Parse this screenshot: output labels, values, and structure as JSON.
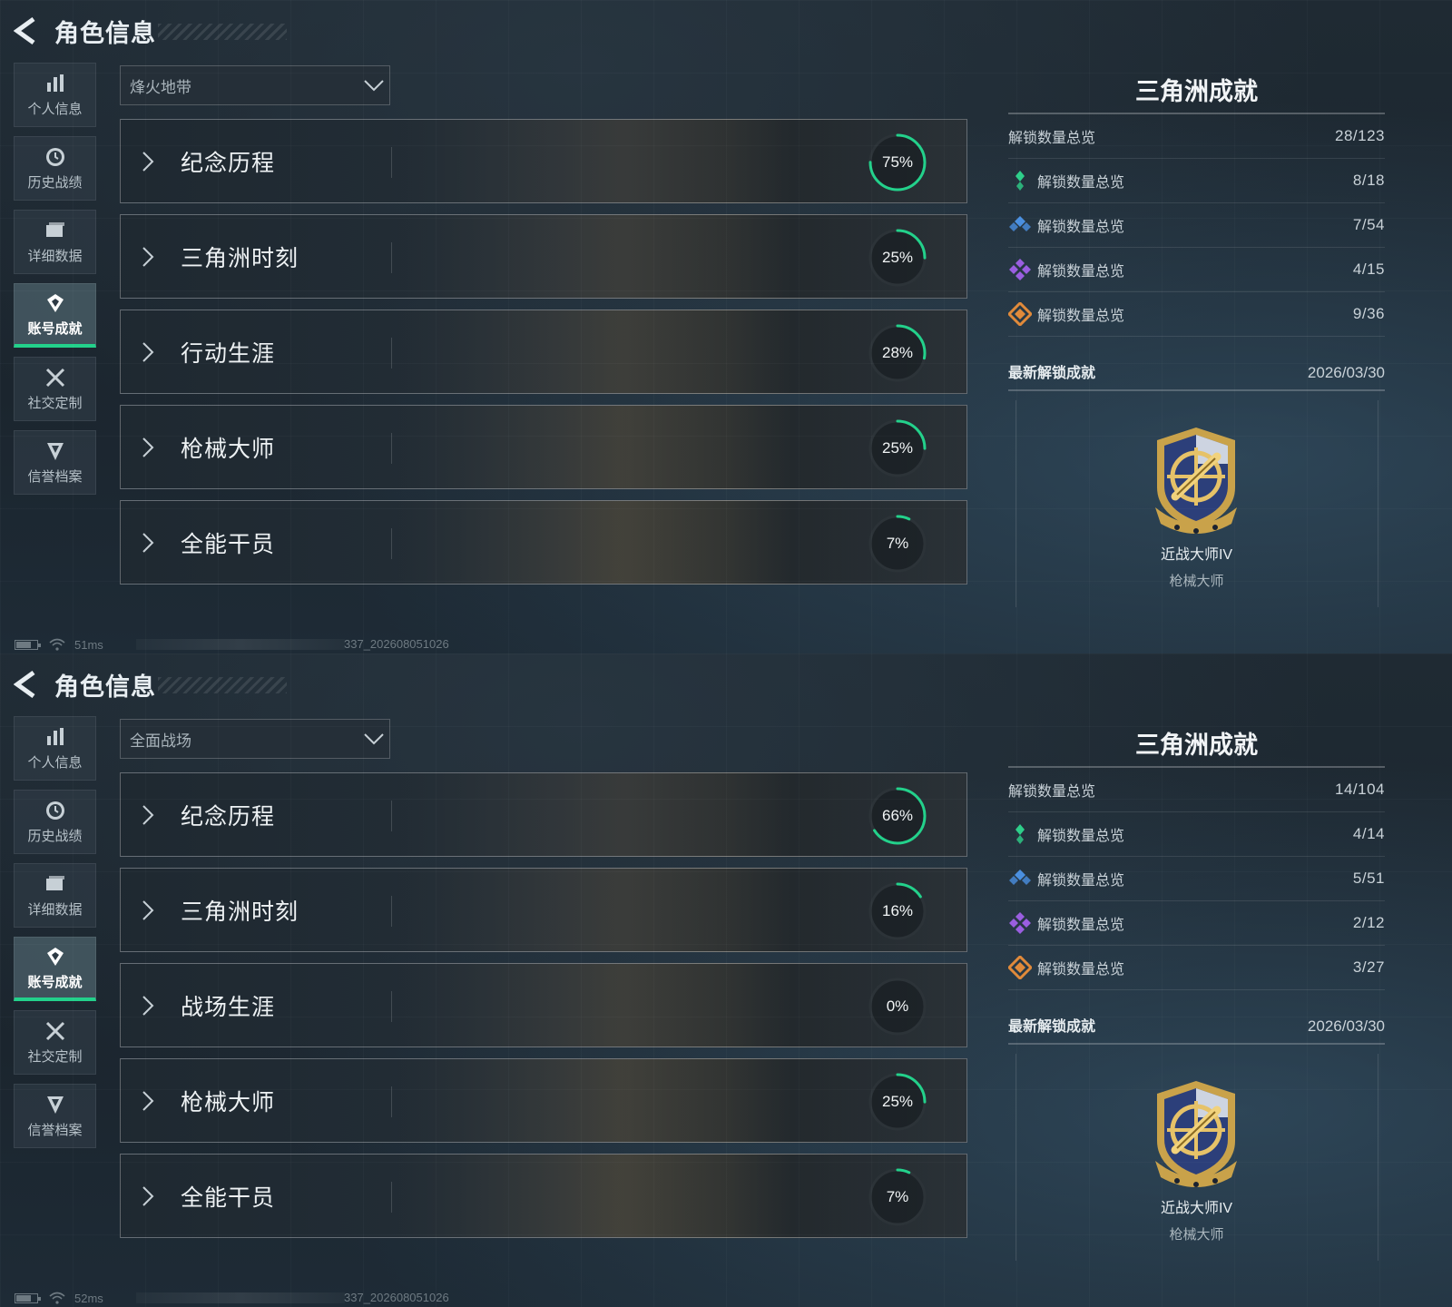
{
  "panels": [
    {
      "header_title": "角色信息",
      "nav": [
        "个人信息",
        "历史战绩",
        "详细数据",
        "账号成就",
        "社交定制",
        "信誉档案"
      ],
      "active_nav": "账号成就",
      "mode_dropdown": "烽火地带",
      "categories": [
        {
          "label": "纪念历程",
          "progress": "75%",
          "value": 0.75
        },
        {
          "label": "三角洲时刻",
          "progress": "25%",
          "value": 0.25
        },
        {
          "label": "行动生涯",
          "progress": "28%",
          "value": 0.28
        },
        {
          "label": "枪械大师",
          "progress": "25%",
          "value": 0.25
        },
        {
          "label": "全能干员",
          "progress": "7%",
          "value": 0.07
        }
      ],
      "achievements": {
        "title": "三角洲成就",
        "summary_label": "解锁数量总览",
        "summary_value": "28/123",
        "tiers": [
          {
            "label": "解锁数量总览",
            "value": "8/18",
            "gem": "green-gem-icon",
            "color": "#2ecf8a"
          },
          {
            "label": "解锁数量总览",
            "value": "7/54",
            "gem": "blue-gem-icon",
            "color": "#4a8fe0"
          },
          {
            "label": "解锁数量总览",
            "value": "4/15",
            "gem": "purple-gem-icon",
            "color": "#9a5ee0"
          },
          {
            "label": "解锁数量总览",
            "value": "9/36",
            "gem": "orange-gem-icon",
            "color": "#e08a3a"
          }
        ],
        "latest_label": "最新解锁成就",
        "latest_date": "2026/03/30",
        "badge_name": "近战大师IV",
        "badge_category": "枪械大师"
      },
      "status": {
        "ping": "51ms",
        "build": "337_202608051026"
      }
    },
    {
      "header_title": "角色信息",
      "nav": [
        "个人信息",
        "历史战绩",
        "详细数据",
        "账号成就",
        "社交定制",
        "信誉档案"
      ],
      "active_nav": "账号成就",
      "mode_dropdown": "全面战场",
      "categories": [
        {
          "label": "纪念历程",
          "progress": "66%",
          "value": 0.66
        },
        {
          "label": "三角洲时刻",
          "progress": "16%",
          "value": 0.16
        },
        {
          "label": "战场生涯",
          "progress": "0%",
          "value": 0.0
        },
        {
          "label": "枪械大师",
          "progress": "25%",
          "value": 0.25
        },
        {
          "label": "全能干员",
          "progress": "7%",
          "value": 0.07
        }
      ],
      "achievements": {
        "title": "三角洲成就",
        "summary_label": "解锁数量总览",
        "summary_value": "14/104",
        "tiers": [
          {
            "label": "解锁数量总览",
            "value": "4/14",
            "gem": "green-gem-icon",
            "color": "#2ecf8a"
          },
          {
            "label": "解锁数量总览",
            "value": "5/51",
            "gem": "blue-gem-icon",
            "color": "#4a8fe0"
          },
          {
            "label": "解锁数量总览",
            "value": "2/12",
            "gem": "purple-gem-icon",
            "color": "#9a5ee0"
          },
          {
            "label": "解锁数量总览",
            "value": "3/27",
            "gem": "orange-gem-icon",
            "color": "#e08a3a"
          }
        ],
        "latest_label": "最新解锁成就",
        "latest_date": "2026/03/30",
        "badge_name": "近战大师IV",
        "badge_category": "枪械大师"
      },
      "status": {
        "ping": "52ms",
        "build": "337_202608051026"
      }
    }
  ],
  "colors": {
    "accent": "#23d18b",
    "ring_track": "#2c3338"
  }
}
